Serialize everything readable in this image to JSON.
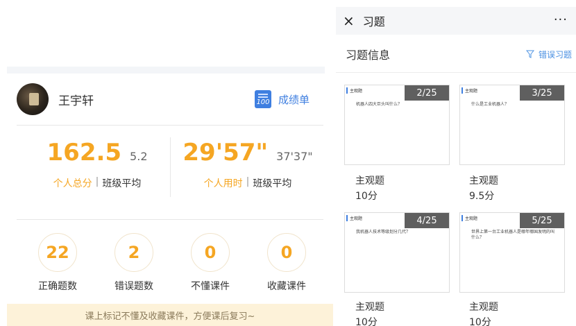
{
  "left": {
    "student_name": "王宇轩",
    "report_icon_text": "100",
    "report_label": "成绩单",
    "score": {
      "own": "162.5",
      "avg": "5.2",
      "own_label": "个人总分",
      "sep": "|",
      "avg_label": "班级平均"
    },
    "time": {
      "own": "29'57\"",
      "avg": "37'37\"",
      "own_label": "个人用时",
      "sep": "|",
      "avg_label": "班级平均"
    },
    "counters": [
      {
        "value": "22",
        "label": "正确题数"
      },
      {
        "value": "2",
        "label": "错误题数"
      },
      {
        "value": "0",
        "label": "不懂课件"
      },
      {
        "value": "0",
        "label": "收藏课件"
      }
    ],
    "tip": "课上标记不懂及收藏课件，方便课后复习~"
  },
  "right": {
    "close_icon": "×",
    "nav_title": "习题",
    "more_icon": "···",
    "info_title": "习题信息",
    "filter_label": "错误习题",
    "cards": [
      {
        "badge": "2/25",
        "tag": "主观题",
        "question": "机器人四大巨头叫什么？",
        "type": "主观题",
        "score": "10分"
      },
      {
        "badge": "3/25",
        "tag": "主观题",
        "question": "什么是工业机器人？",
        "type": "主观题",
        "score": "9.5分"
      },
      {
        "badge": "4/25",
        "tag": "主观题",
        "question": "我机器人技术等级划分几代？",
        "type": "主观题",
        "score": "10分"
      },
      {
        "badge": "5/25",
        "tag": "主观题",
        "question": "世界上第一台工业机器人是哪年哪国发明的叫什么？",
        "type": "主观题",
        "score": "10分"
      }
    ]
  },
  "colors": {
    "accent": "#f5a623",
    "link": "#3f7fe0",
    "tip_bg": "#fdf2d9",
    "badge_bg": "#5f5f5f"
  }
}
